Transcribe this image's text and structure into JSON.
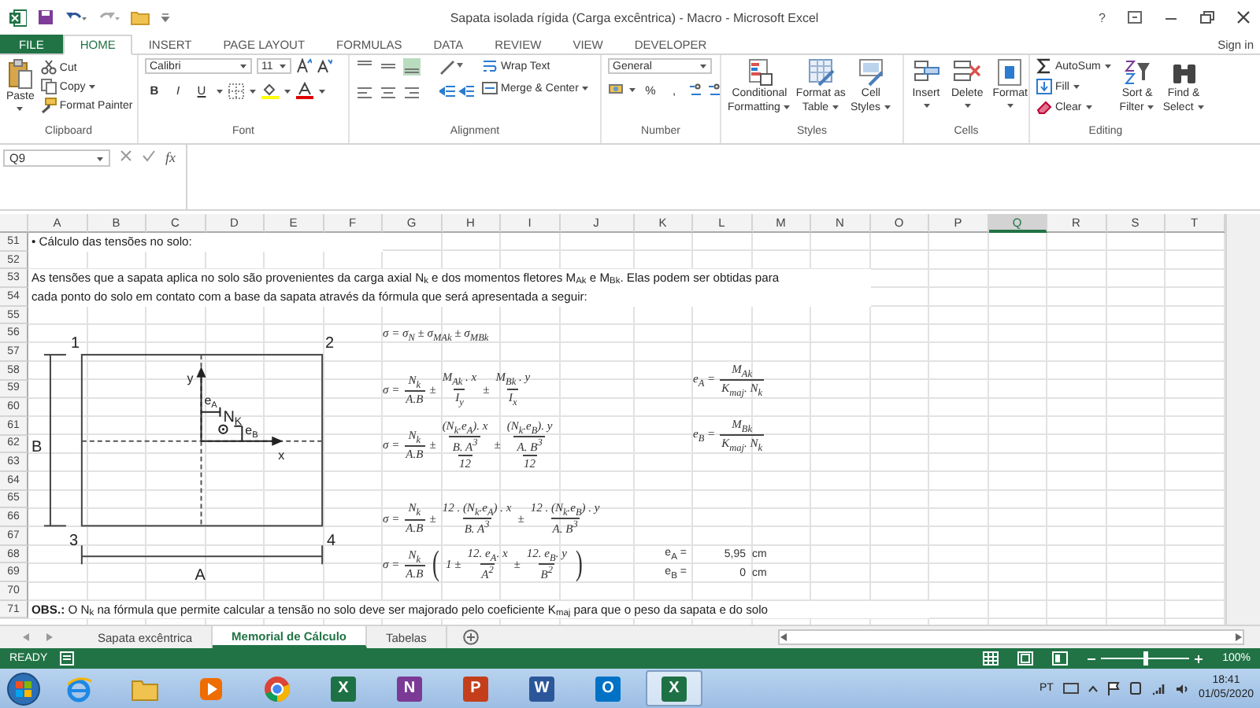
{
  "window": {
    "title": "Sapata isolada rígida (Carga excêntrica) - Macro - Microsoft Excel",
    "help": "?"
  },
  "ribbon_tabs": [
    {
      "label": "FILE",
      "kind": "file",
      "selected": false
    },
    {
      "label": "HOME",
      "kind": "tab",
      "selected": true
    },
    {
      "label": "INSERT",
      "kind": "tab",
      "selected": false
    },
    {
      "label": "PAGE LAYOUT",
      "kind": "tab",
      "selected": false
    },
    {
      "label": "FORMULAS",
      "kind": "tab",
      "selected": false
    },
    {
      "label": "DATA",
      "kind": "tab",
      "selected": false
    },
    {
      "label": "REVIEW",
      "kind": "tab",
      "selected": false
    },
    {
      "label": "VIEW",
      "kind": "tab",
      "selected": false
    },
    {
      "label": "DEVELOPER",
      "kind": "tab",
      "selected": false
    }
  ],
  "account": "Sign in",
  "ribbon": {
    "clipboard": {
      "paste": "Paste",
      "items": [
        "Cut",
        "Copy",
        "Format Painter"
      ],
      "label": "Clipboard"
    },
    "font": {
      "family": "Calibri",
      "size": "11",
      "buttons": [
        "B",
        "I",
        "U"
      ],
      "label": "Font"
    },
    "alignment": {
      "wrap": "Wrap Text",
      "merge": "Merge & Center",
      "label": "Alignment"
    },
    "number": {
      "format": "General",
      "symbols": [
        "%",
        ","
      ],
      "label": "Number"
    },
    "styles": {
      "buttons": [
        [
          "Conditional",
          "Formatting"
        ],
        [
          "Format as",
          "Table"
        ],
        [
          "Cell",
          "Styles"
        ]
      ],
      "label": "Styles"
    },
    "cells": {
      "buttons": [
        "Insert",
        "Delete",
        "Format"
      ],
      "label": "Cells"
    },
    "editing": {
      "autosum": "AutoSum",
      "fill": "Fill",
      "clear": "Clear",
      "sort": [
        "Sort &",
        "Filter"
      ],
      "find": [
        "Find &",
        "Select"
      ],
      "label": "Editing"
    }
  },
  "formula_bar": {
    "name_box": "Q9",
    "fx": "fx"
  },
  "sheet": {
    "columns": [
      {
        "label": "A",
        "selected": false
      },
      {
        "label": "B",
        "selected": false
      },
      {
        "label": "C",
        "selected": false
      },
      {
        "label": "D",
        "selected": false
      },
      {
        "label": "E",
        "selected": false
      },
      {
        "label": "F",
        "selected": false
      },
      {
        "label": "G",
        "selected": false
      },
      {
        "label": "H",
        "selected": false
      },
      {
        "label": "I",
        "selected": false
      },
      {
        "label": "J",
        "selected": false
      },
      {
        "label": "K",
        "selected": false
      },
      {
        "label": "L",
        "selected": false
      },
      {
        "label": "M",
        "selected": false
      },
      {
        "label": "N",
        "selected": false
      },
      {
        "label": "O",
        "selected": false
      },
      {
        "label": "P",
        "selected": false
      },
      {
        "label": "Q",
        "selected": true
      },
      {
        "label": "R",
        "selected": false
      },
      {
        "label": "S",
        "selected": false
      },
      {
        "label": "T",
        "selected": false
      }
    ],
    "rows": [
      "51",
      "52",
      "53",
      "54",
      "55",
      "56",
      "57",
      "58",
      "59",
      "60",
      "61",
      "62",
      "63",
      "64",
      "65",
      "66",
      "67",
      "68",
      "69",
      "70",
      "71"
    ],
    "heading": "• Cálculo das tensões no solo:",
    "intro": [
      "As tensões que a sapata aplica no solo são provenientes da carga axial N$_{k}$ e dos momentos fletores M$_{Ak}$ e M$_{Bk}$. Elas podem ser obtidas para",
      "cada ponto do solo em contato com a base da sapata através da fórmula que será apresentada a seguir:"
    ],
    "diagram": {
      "corners": [
        "1",
        "2",
        "3",
        "4"
      ],
      "width_label": "A",
      "height_label": "B",
      "x_axis": "x",
      "y_axis": "y",
      "ecc_a": {
        "text": "e",
        "sub": "A"
      },
      "load": {
        "text": "N",
        "sub": "K"
      },
      "ecc_b": {
        "text": "e",
        "sub": "B"
      }
    },
    "equations": [
      [
        {
          "kind": "text",
          "text": "σ = σ$_{N}$ ± σ$_{MAk}$ ± σ$_{MBk}$"
        }
      ],
      [
        {
          "kind": "text",
          "text": "σ ="
        },
        {
          "kind": "frac",
          "num": "N$_{k}$",
          "den": "A.B"
        },
        {
          "kind": "text",
          "text": "±"
        },
        {
          "kind": "frac",
          "num": "M$_{Ak}$ . x",
          "den": "I$_{y}$"
        },
        {
          "kind": "text",
          "text": "±"
        },
        {
          "kind": "frac",
          "num": "M$_{Bk}$ . y",
          "den": "I$_{x}$"
        }
      ],
      [
        {
          "kind": "text",
          "text": "σ ="
        },
        {
          "kind": "frac",
          "num": "N$_{k}$",
          "den": "A.B"
        },
        {
          "kind": "text",
          "text": "±"
        },
        {
          "kind": "frac",
          "num": "(N$_{k}$.e$_{A}$). x",
          "den": {
            "kind": "frac",
            "num": "B. A$^{3}$",
            "den": "12"
          }
        },
        {
          "kind": "text",
          "text": "±"
        },
        {
          "kind": "frac",
          "num": "(N$_{k}$.e$_{B}$). y",
          "den": {
            "kind": "frac",
            "num": "A. B$^{3}$",
            "den": "12"
          }
        }
      ],
      [
        {
          "kind": "text",
          "text": "σ ="
        },
        {
          "kind": "frac",
          "num": "N$_{k}$",
          "den": "A.B"
        },
        {
          "kind": "text",
          "text": "±"
        },
        {
          "kind": "frac",
          "num": "12 . (N$_{k}$.e$_{A}$) . x",
          "den": "B. A$^{3}$"
        },
        {
          "kind": "text",
          "text": "±"
        },
        {
          "kind": "frac",
          "num": "12 . (N$_{k}$.e$_{B}$) . y",
          "den": "A. B$^{3}$"
        }
      ],
      [
        {
          "kind": "text",
          "text": "σ ="
        },
        {
          "kind": "frac",
          "num": "N$_{k}$",
          "den": "A.B"
        },
        {
          "kind": "paren",
          "text": "("
        },
        {
          "kind": "text",
          "text": "1 ±"
        },
        {
          "kind": "frac",
          "num": "12. e$_{A}$. x",
          "den": "A$^{2}$"
        },
        {
          "kind": "text",
          "text": "±"
        },
        {
          "kind": "frac",
          "num": "12. e$_{B}$. y",
          "den": "B$^{2}$"
        },
        {
          "kind": "paren",
          "text": ")"
        }
      ]
    ],
    "eccentricity_equations": [
      [
        {
          "kind": "text",
          "text": "e$_{A}$ ="
        },
        {
          "kind": "frac",
          "num": "M$_{Ak}$",
          "den": "K$_{maj}$. N$_{k}$"
        }
      ],
      [
        {
          "kind": "text",
          "text": "e$_{B}$ ="
        },
        {
          "kind": "frac",
          "num": "M$_{Bk}$",
          "den": "K$_{maj}$. N$_{k}$"
        }
      ]
    ],
    "results": [
      {
        "label": "e$_{A}$ =",
        "value": "5,95",
        "unit": "cm"
      },
      {
        "label": "e$_{B}$ =",
        "value": "0",
        "unit": "cm"
      }
    ],
    "note": "**OBS.:** O N$_{k}$ na fórmula que permite calcular a tensão no solo deve ser majorado pelo coeficiente K$_{maj}$ para que o peso da sapata e do solo"
  },
  "sheet_tabs": [
    {
      "label": "Sapata excêntrica",
      "selected": false
    },
    {
      "label": "Memorial de Cálculo",
      "selected": true
    },
    {
      "label": "Tabelas",
      "selected": false
    }
  ],
  "status_bar": {
    "mode": "READY",
    "zoom": {
      "level": 0.5,
      "reading": "100%"
    }
  },
  "taskbar": {
    "apps": [
      {
        "kind": "browser",
        "active": false
      },
      {
        "kind": "folder",
        "active": false
      },
      {
        "kind": "media",
        "active": false
      },
      {
        "kind": "chrome",
        "active": false
      },
      {
        "kind": "office",
        "glyph": "X",
        "color": "#1e7145",
        "active": false
      },
      {
        "kind": "office",
        "glyph": "N",
        "color": "#7b3a96",
        "active": false
      },
      {
        "kind": "office",
        "glyph": "P",
        "color": "#c43e1c",
        "active": false
      },
      {
        "kind": "office",
        "glyph": "W",
        "color": "#2b579a",
        "active": false
      },
      {
        "kind": "office",
        "glyph": "O",
        "color": "#0072c6",
        "active": false
      },
      {
        "kind": "office",
        "glyph": "X",
        "color": "#1e7145",
        "active": true
      }
    ],
    "language": "PT",
    "time": "18:41",
    "date": "01/05/2020"
  }
}
